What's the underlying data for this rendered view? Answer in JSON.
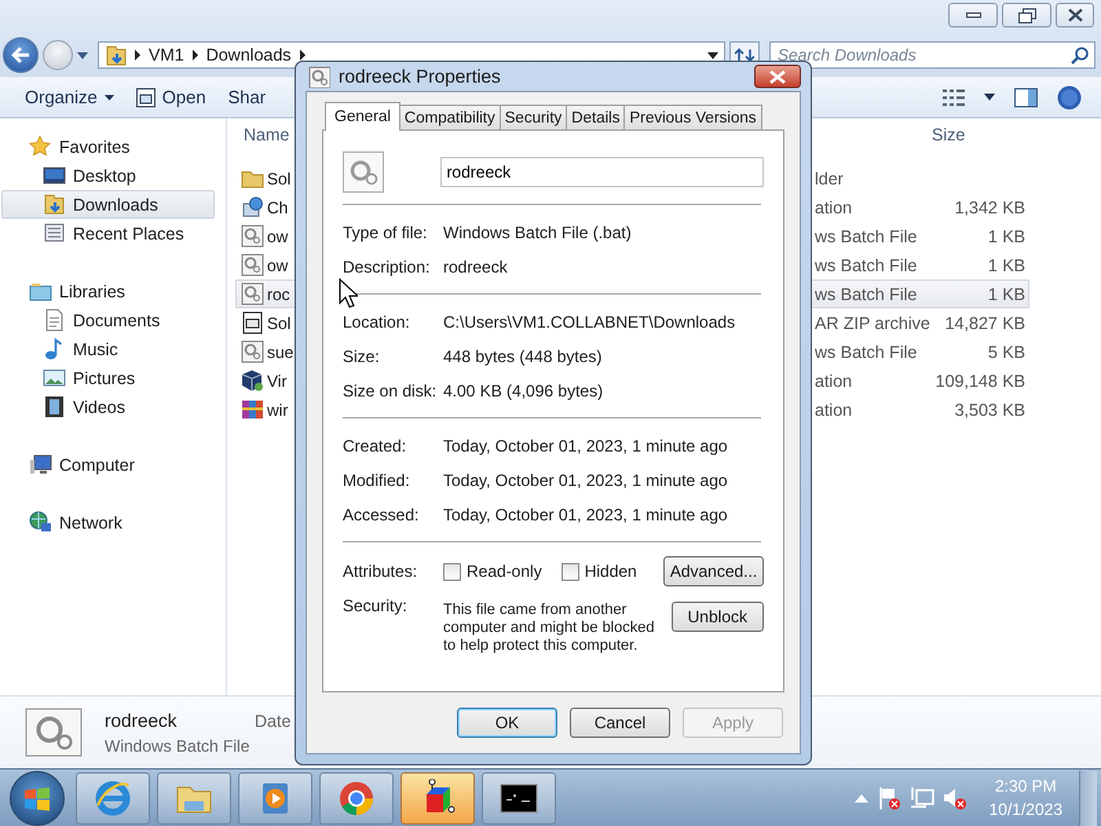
{
  "explorer": {
    "address": {
      "segments": [
        "VM1",
        "Downloads"
      ]
    },
    "search": {
      "placeholder": "Search Downloads"
    },
    "toolbar": [
      {
        "label": "Organize",
        "kind": "menu"
      },
      {
        "label": "Open",
        "kind": "icon"
      },
      {
        "label": "Shar",
        "kind": "plain"
      }
    ],
    "navigation": [
      {
        "label": "Favorites",
        "selected": false,
        "children": [
          {
            "label": "Desktop",
            "selected": false
          },
          {
            "label": "Downloads",
            "selected": true
          },
          {
            "label": "Recent Places",
            "selected": false
          }
        ]
      },
      {
        "label": "Libraries",
        "selected": false,
        "children": [
          {
            "label": "Documents",
            "selected": false
          },
          {
            "label": "Music",
            "selected": false
          },
          {
            "label": "Pictures",
            "selected": false
          },
          {
            "label": "Videos",
            "selected": false
          }
        ]
      },
      {
        "label": "Computer",
        "selected": false
      },
      {
        "label": "Network",
        "selected": false
      }
    ],
    "columns": {
      "name": "Name",
      "size": "Size"
    },
    "files": [
      {
        "name": "Sol",
        "type": "lder",
        "selected": false
      },
      {
        "name": "Ch",
        "type": "ation",
        "size": "1,342 KB",
        "selected": false
      },
      {
        "name": "ow",
        "type": "ws Batch File",
        "size": "1 KB",
        "selected": false
      },
      {
        "name": "ow",
        "type": "ws Batch File",
        "size": "1 KB",
        "selected": false
      },
      {
        "name": "roc",
        "type": "ws Batch File",
        "size": "1 KB",
        "selected": true
      },
      {
        "name": "Sol",
        "type": "AR ZIP archive",
        "size": "14,827 KB",
        "selected": false
      },
      {
        "name": "sue",
        "type": "ws Batch File",
        "size": "5 KB",
        "selected": false
      },
      {
        "name": "Vir",
        "type": "ation",
        "size": "109,148 KB",
        "selected": false
      },
      {
        "name": "wir",
        "type": "ation",
        "size": "3,503 KB",
        "selected": false
      }
    ],
    "details": {
      "name": "rodreeck",
      "type": "Windows Batch File",
      "column_label": "Date"
    }
  },
  "dialog": {
    "title": "rodreeck Properties",
    "tabs": [
      {
        "label": "General",
        "selected": true
      },
      {
        "label": "Compatibility",
        "selected": false
      },
      {
        "label": "Security",
        "selected": false
      },
      {
        "label": "Details",
        "selected": false
      },
      {
        "label": "Previous Versions",
        "selected": false
      }
    ],
    "file_name": "rodreeck",
    "groups": [
      [
        {
          "label": "Type of file:",
          "value": "Windows Batch File (.bat)"
        },
        {
          "label": "Description:",
          "value": "rodreeck"
        }
      ],
      [
        {
          "label": "Location:",
          "value": "C:\\Users\\VM1.COLLABNET\\Downloads"
        },
        {
          "label": "Size:",
          "value": "448 bytes (448 bytes)"
        },
        {
          "label": "Size on disk:",
          "value": "4.00 KB (4,096 bytes)"
        }
      ],
      [
        {
          "label": "Created:",
          "value": "Today, October 01, 2023, 1 minute ago"
        },
        {
          "label": "Modified:",
          "value": "Today, October 01, 2023, 1 minute ago"
        },
        {
          "label": "Accessed:",
          "value": "Today, October 01, 2023, 1 minute ago"
        }
      ]
    ],
    "attributes": {
      "label": "Attributes:",
      "options": [
        {
          "label": "Read-only",
          "checked": false
        },
        {
          "label": "Hidden",
          "checked": false
        }
      ],
      "button": "Advanced..."
    },
    "security": {
      "label": "Security:",
      "text": "This file came from another computer and might be blocked to help protect this computer.",
      "button": "Unblock"
    },
    "buttons": [
      {
        "label": "OK",
        "default": true,
        "disabled": false
      },
      {
        "label": "Cancel",
        "default": false,
        "disabled": false
      },
      {
        "label": "Apply",
        "default": false,
        "disabled": true
      }
    ]
  },
  "taskbar": {
    "apps": [
      {
        "active": false
      },
      {
        "active": false
      },
      {
        "active": false
      },
      {
        "active": false
      },
      {
        "active": true
      },
      {
        "active": false
      }
    ],
    "clock": {
      "time": "2:30 PM",
      "date": "10/1/2023"
    }
  }
}
